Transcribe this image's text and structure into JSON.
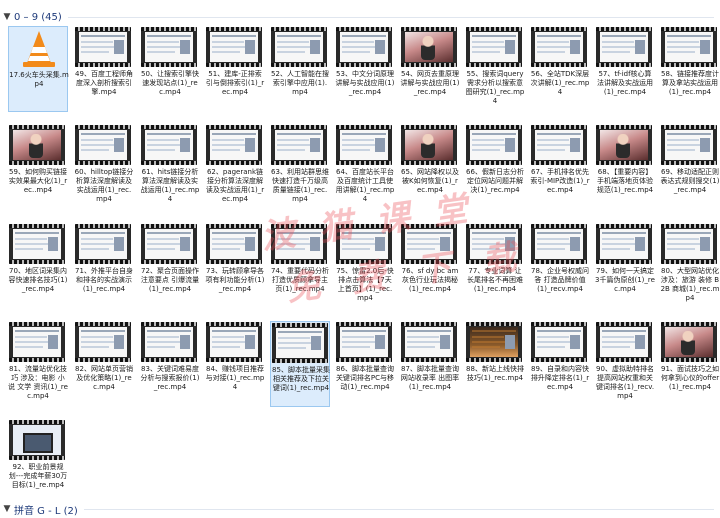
{
  "groups": [
    {
      "label": "0 – 9 (45)",
      "icon": "chevron-down-icon"
    },
    {
      "label": "拼音 G - L (2)",
      "icon": "chevron-down-icon"
    }
  ],
  "watermark": {
    "line1": "波 猫 课 堂",
    "line2": "免 费 下 载"
  },
  "colors": {
    "selection": "#dcecfc",
    "group_text": "#1e3a7a",
    "watermark": "#eb505a"
  },
  "files": [
    {
      "name": "17.6火车头采集.mp4",
      "thumb": "vlc-cone-icon",
      "selected": true
    },
    {
      "name": "49、百度工程师角度深入剖析搜索引擎.mp4",
      "thumb": "video-doc"
    },
    {
      "name": "50、让搜索引擎快速发现站点(1)_rec.mp4",
      "thumb": "video-doc"
    },
    {
      "name": "51、建库-正排索引与倒排索引(1)_rec.mp4",
      "thumb": "video-doc"
    },
    {
      "name": "52、人工智能在搜索引擎中应用(1).mp4",
      "thumb": "video-doc"
    },
    {
      "name": "53、中文分词原理讲解与实战应用(1)_rec.mp4",
      "thumb": "video-doc"
    },
    {
      "name": "54、网页去重原理讲解与实战应用(1)_rec.mp4",
      "thumb": "video-photo"
    },
    {
      "name": "55、搜索词query需求分析以搜索意图研究(1)_rec.mp4",
      "thumb": "video-doc"
    },
    {
      "name": "56、全站TDK深层次讲解(1)_rec.mp4",
      "thumb": "video-doc"
    },
    {
      "name": "57、tf-idf核心算法讲解及实战运用(1)_rec.mp4",
      "thumb": "video-doc"
    },
    {
      "name": "58、链接推荐度计算及拿站实战运用(1)_rec.mp4",
      "thumb": "video-doc"
    },
    {
      "name": "59、如何购买链接实效果最大化(1)_rec..mp4",
      "thumb": "video-photo"
    },
    {
      "name": "60、hilltop链接分析算法深度解读及实战运用(1)_rec.mp4",
      "thumb": "video-doc"
    },
    {
      "name": "61、hits链接分析算法深度解读及实战运用(1)_rec.mp4",
      "thumb": "video-doc"
    },
    {
      "name": "62、pagerank链接分析算法深度解读及实战运用(1)_rec.mp4",
      "thumb": "video-doc"
    },
    {
      "name": "63、利用站群思维快速打造千万级高质量链接(1)_rec.mp4",
      "thumb": "video-doc"
    },
    {
      "name": "64、百度站长平台及百度统计工具使用讲解(1)_rec.mp4",
      "thumb": "video-doc"
    },
    {
      "name": "65、网站降权以及被K如何恢复(1)_rec.mp4",
      "thumb": "video-photo"
    },
    {
      "name": "66、假新日志分析定位网站问题并解决(1)_rec.mp4",
      "thumb": "video-doc"
    },
    {
      "name": "67、手机排名优先索引-MIP改造(1)_rec.mp4",
      "thumb": "video-doc"
    },
    {
      "name": "68、【重要内容】手机端落地页体验规范(1)_rec.mp4",
      "thumb": "video-photo"
    },
    {
      "name": "69、移动适配正则表达式规则搜交(1)_rec.mp4",
      "thumb": "video-doc"
    },
    {
      "name": "70、地区词采集内容快速排名技巧(1)_rec.mp4",
      "thumb": "video-doc"
    },
    {
      "name": "71、外推平台自身和排名的实战演示(1)_rec.mp4",
      "thumb": "video-doc"
    },
    {
      "name": "72、聚合页面操作注意要点 引爆流量(1)_rec.mp4",
      "thumb": "video-doc"
    },
    {
      "name": "73、玩转顾拿导各项有利功能分析(1)_rec.mp4",
      "thumb": "video-doc"
    },
    {
      "name": "74、重要代码分析打造优质顾拿导主页(1)_rec.mp4",
      "thumb": "video-doc"
    },
    {
      "name": "75、惊雷2.0后-快排点击算法【7天上首页】(1)_rec.mp4",
      "thumb": "video-doc"
    },
    {
      "name": "76、sf dy bc am 灰色行业玩法揭秘(1)_rec.mp4",
      "thumb": "video-doc"
    },
    {
      "name": "77、专业词算 让长尾排名不再困难(1)_rec.mp4",
      "thumb": "video-doc"
    },
    {
      "name": "78、企业号权威问答 打造品牌价值(1)_recv.mp4",
      "thumb": "video-doc"
    },
    {
      "name": "79、如何一天搞定3千篇伪原创(1)_rec.mp4",
      "thumb": "video-doc"
    },
    {
      "name": "80、大型网站优化 涉及：旅游 装修 B2B 商城(1)_rec.mp4",
      "thumb": "video-doc"
    },
    {
      "name": "81、流量站优化技巧 涉及：电影 小说 文学 资讯(1)_rec.mp4",
      "thumb": "video-doc"
    },
    {
      "name": "82、网站单页营销及优化策略(1)_rec.mp4",
      "thumb": "video-doc"
    },
    {
      "name": "83、关键词难易度分析与搜索报价(1)_rec.mp4",
      "thumb": "video-doc"
    },
    {
      "name": "84、赚钱项目推荐与对接(1)_rec.mp4",
      "thumb": "video-doc"
    },
    {
      "name": "85、脚本批量采集相关推荐及下拉关键词(1)_rec.mp4",
      "thumb": "video-doc",
      "selected": true
    },
    {
      "name": "86、脚本批量查询关键词排名PC与移动(1)_rec.mp4",
      "thumb": "video-doc"
    },
    {
      "name": "87、脚本批量查询网站收录率 出图率(1)_rec.mp4",
      "thumb": "video-doc"
    },
    {
      "name": "88、新站上线快排技巧(1)_rec.mp4",
      "thumb": "video-dark"
    },
    {
      "name": "89、自录和内容快排升降定排名(1)_rec.mp4",
      "thumb": "video-doc"
    },
    {
      "name": "90、虚拟助特排名提高网站权重和关键词排名(1)_recv.mp4",
      "thumb": "video-doc"
    },
    {
      "name": "91、面试技巧之如何拿到心仪的offer(1)_rec.mp4",
      "thumb": "video-photo"
    },
    {
      "name": "92、职业前景规划---完成年薪30万目标(1)_re.mp4",
      "thumb": "video-laptop"
    }
  ]
}
